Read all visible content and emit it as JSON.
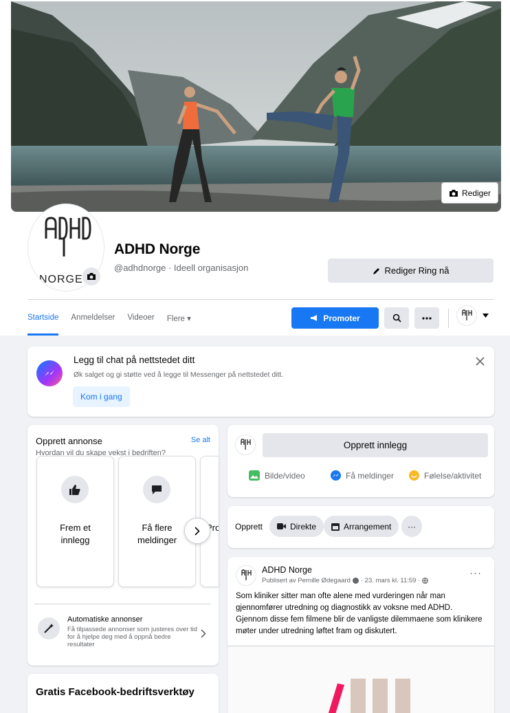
{
  "colors": {
    "brand_blue": "#1877f2",
    "page_bg": "#f0f2f5",
    "card_bg": "#ffffff",
    "button_gray": "#e4e6eb",
    "secondary_text": "#65676b"
  },
  "cover": {
    "edit_label": "Rediger",
    "icon": "camera-icon"
  },
  "profile": {
    "logo_text_top": "ADHD",
    "logo_text_bottom": "NORGE",
    "name": "ADHD Norge",
    "subtitle": "@adhdnorge · Ideell organisasjon",
    "edit_button_label": "Rediger Ring nå"
  },
  "nav": {
    "tabs": [
      {
        "label": "Startside",
        "active": true
      },
      {
        "label": "Anmeldelser",
        "active": false
      },
      {
        "label": "Videoer",
        "active": false
      },
      {
        "label": "Flere ▾",
        "active": false
      }
    ],
    "promote_label": "Promoter",
    "icons": [
      "megaphone-icon",
      "search-icon",
      "more-icon",
      "chevron-down-icon"
    ]
  },
  "chat_prompt": {
    "title": "Legg til chat på nettstedet ditt",
    "text": "Øk salget og gi støtte ved å legge til Messenger på nettstedet ditt.",
    "button_label": "Kom i gang",
    "close_label": "X"
  },
  "ad_panel": {
    "title": "Opprett annonse",
    "see_all": "Se alt",
    "subtitle": "Hvordan vil du skape vekst i bedriften?",
    "options": [
      {
        "label_line1": "Frem et",
        "label_line2": "innlegg",
        "icon": "thumbs-up-icon"
      },
      {
        "label_line1": "Få flere",
        "label_line2": "meldinger",
        "icon": "chat-bubble-icon"
      },
      {
        "label_line1": "Pro",
        "label_line2": "",
        "icon": "none"
      }
    ],
    "auto_title": "Automatiske annonser",
    "auto_text": "Få tilpassede annonser som justeres over tid for å hjelpe deg med å oppnå bedre resultater"
  },
  "tools_panel": {
    "title": "Gratis Facebook-bedriftsverktøy"
  },
  "composer": {
    "placeholder": "Opprett innlegg",
    "actions": [
      {
        "label": "Bilde/video",
        "icon": "photo-icon",
        "color": "#45bd62"
      },
      {
        "label": "Få meldinger",
        "icon": "messenger-icon",
        "color": "#1877f2"
      },
      {
        "label": "Følelse/aktivitet",
        "icon": "smiley-icon",
        "color": "#f7b928"
      }
    ]
  },
  "create_row": {
    "label": "Opprett",
    "pills": [
      {
        "label": "Direkte",
        "icon": "live-video-icon"
      },
      {
        "label": "Arrangement",
        "icon": "calendar-icon"
      },
      {
        "label": "···",
        "icon": "more-icon"
      }
    ]
  },
  "post": {
    "author": "ADHD Norge",
    "meta": "Publisert av Pernille Ødegaard",
    "date": "· 23. mars kl. 11:59 ·",
    "more": "···",
    "lines": [
      "Som kliniker sitter man ofte alene med vurderingen når man",
      "gjennomfører utredning og diagnostikk av voksne med ADHD.",
      "Gjennom disse fem filmene blir de vanligste dilemmaene som klinikere",
      "møter under utredning løftet fram og diskutert."
    ]
  }
}
